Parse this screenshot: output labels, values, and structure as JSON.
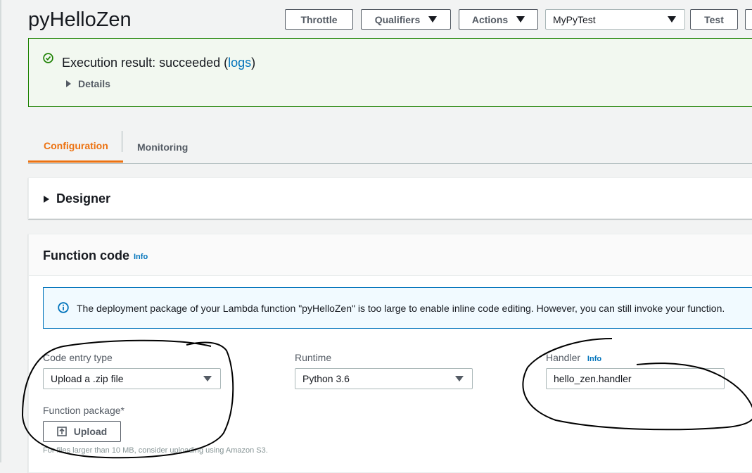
{
  "page": {
    "title": "pyHelloZen"
  },
  "toolbar": {
    "throttle_label": "Throttle",
    "qualifiers_label": "Qualifiers",
    "actions_label": "Actions",
    "test_event_selected": "MyPyTest",
    "test_label": "Test"
  },
  "flash": {
    "message_prefix": "Execution result: succeeded (",
    "logs_link": "logs",
    "message_suffix": ")",
    "details_label": "Details",
    "status_color": "#1d8102"
  },
  "tabs": [
    {
      "label": "Configuration",
      "active": true
    },
    {
      "label": "Monitoring",
      "active": false
    }
  ],
  "designer": {
    "title": "Designer"
  },
  "function_code": {
    "title": "Function code",
    "info_label": "Info",
    "alert_text": "The deployment package of your Lambda function \"pyHelloZen\" is too large to enable inline code editing. However, you can still invoke your function.",
    "code_entry_type": {
      "label": "Code entry type",
      "value": "Upload a .zip file"
    },
    "runtime": {
      "label": "Runtime",
      "value": "Python 3.6"
    },
    "handler": {
      "label": "Handler",
      "info_label": "Info",
      "value": "hello_zen.handler"
    },
    "function_package": {
      "label": "Function package*",
      "upload_label": "Upload"
    },
    "hint": "For files larger than 10 MB, consider uploading using Amazon S3."
  },
  "colors": {
    "accent": "#ec7211",
    "link": "#0073bb",
    "success": "#1d8102"
  }
}
